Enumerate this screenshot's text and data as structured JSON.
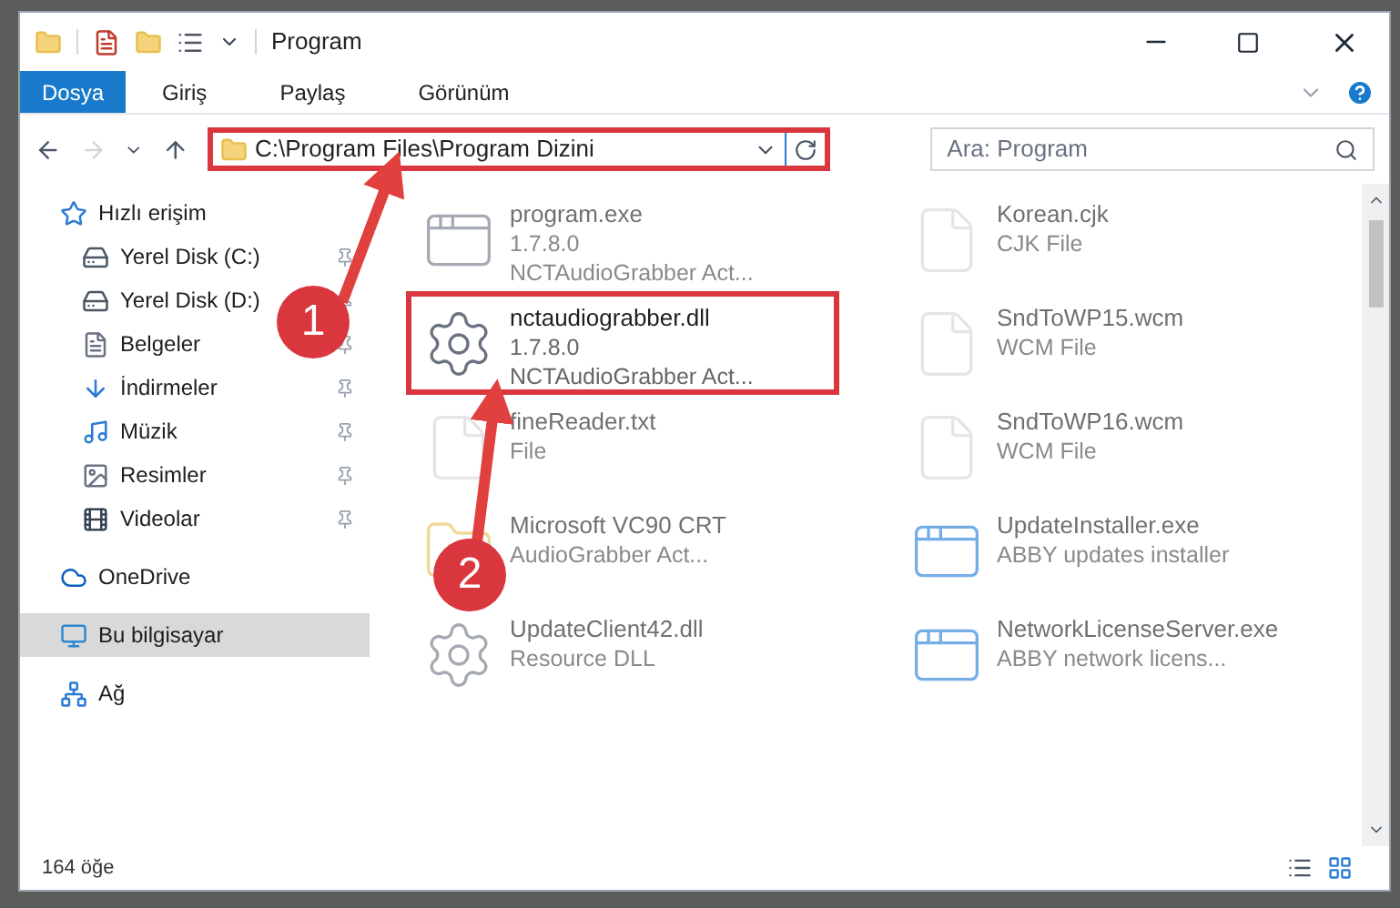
{
  "window": {
    "title": "Program"
  },
  "ribbon_tabs": [
    {
      "label": "Dosya",
      "selected": true
    },
    {
      "label": "Giriş",
      "selected": false
    },
    {
      "label": "Paylaş",
      "selected": false
    },
    {
      "label": "Görünüm",
      "selected": false
    }
  ],
  "address_bar": {
    "value": "C:\\Program Files\\Program Dizini",
    "highlighted": true
  },
  "search": {
    "placeholder": "Ara: Program"
  },
  "sidebar": {
    "items": [
      {
        "kind": "star",
        "label": "Hızlı erişim",
        "pinned": false,
        "selected": false,
        "children": [
          {
            "kind": "disk",
            "label": "Yerel Disk (C:)",
            "pinned": true,
            "selected": false
          },
          {
            "kind": "disk",
            "label": "Yerel Disk (D:)",
            "pinned": true,
            "selected": false
          },
          {
            "kind": "docs",
            "label": "Belgeler",
            "pinned": true,
            "selected": false
          },
          {
            "kind": "download",
            "label": "İndirmeler",
            "pinned": true,
            "selected": false
          },
          {
            "kind": "music",
            "label": "Müzik",
            "pinned": true,
            "selected": false
          },
          {
            "kind": "pictures",
            "label": "Resimler",
            "pinned": true,
            "selected": false
          },
          {
            "kind": "video",
            "label": "Videolar",
            "pinned": true,
            "selected": false
          }
        ]
      },
      {
        "kind": "cloud",
        "label": "OneDrive",
        "pinned": false,
        "selected": false
      },
      {
        "kind": "pc",
        "label": "Bu bilgisayar",
        "pinned": false,
        "selected": true
      },
      {
        "kind": "network",
        "label": "Ağ",
        "pinned": false,
        "selected": false
      }
    ]
  },
  "files": [
    {
      "kind": "app",
      "name": "program.exe",
      "lines": [
        "1.7.8.0",
        "NCTAudioGrabber Act..."
      ],
      "blurred": true,
      "highlighted": false
    },
    {
      "kind": "blank",
      "name": "Korean.cjk",
      "lines": [
        "CJK File"
      ],
      "blurred": true,
      "highlighted": false
    },
    {
      "kind": "dll",
      "name": "nctaudiograbber.dll",
      "lines": [
        "1.7.8.0",
        "NCTAudioGrabber Act..."
      ],
      "blurred": false,
      "highlighted": true
    },
    {
      "kind": "blank",
      "name": "SndToWP15.wcm",
      "lines": [
        "WCM File"
      ],
      "blurred": true,
      "highlighted": false
    },
    {
      "kind": "blank",
      "name": "fineReader.txt",
      "lines": [
        "File"
      ],
      "blurred": true,
      "highlighted": false
    },
    {
      "kind": "blank",
      "name": "SndToWP16.wcm",
      "lines": [
        "WCM File"
      ],
      "blurred": true,
      "highlighted": false
    },
    {
      "kind": "folder",
      "name": "Microsoft VC90 CRT",
      "lines": [
        "AudioGrabber Act..."
      ],
      "blurred": true,
      "highlighted": false
    },
    {
      "kind": "installer",
      "name": "UpdateInstaller.exe",
      "lines": [
        "ABBY updates installer"
      ],
      "blurred": true,
      "highlighted": false
    },
    {
      "kind": "dll",
      "name": "UpdateClient42.dll",
      "lines": [
        "Resource DLL"
      ],
      "blurred": true,
      "highlighted": false
    },
    {
      "kind": "installer",
      "name": "NetworkLicenseServer.exe",
      "lines": [
        "ABBY network licens..."
      ],
      "blurred": true,
      "highlighted": false
    }
  ],
  "status_bar": {
    "count": "164 öğe"
  },
  "callouts": [
    "1",
    "2"
  ]
}
